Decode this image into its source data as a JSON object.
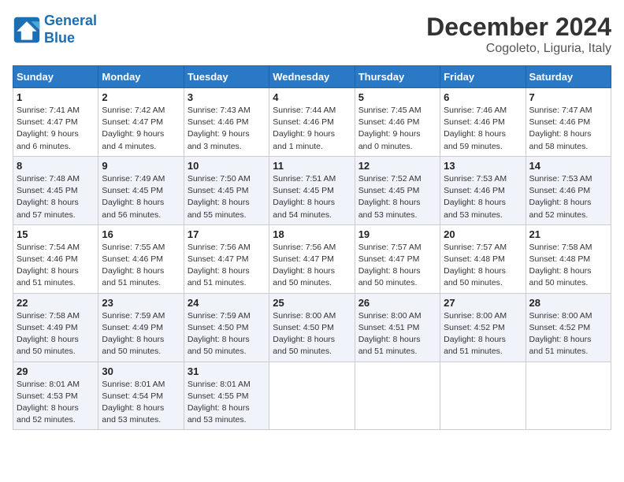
{
  "header": {
    "logo_line1": "General",
    "logo_line2": "Blue",
    "month": "December 2024",
    "location": "Cogoleto, Liguria, Italy"
  },
  "weekdays": [
    "Sunday",
    "Monday",
    "Tuesday",
    "Wednesday",
    "Thursday",
    "Friday",
    "Saturday"
  ],
  "weeks": [
    [
      {
        "day": "1",
        "info": "Sunrise: 7:41 AM\nSunset: 4:47 PM\nDaylight: 9 hours\nand 6 minutes."
      },
      {
        "day": "2",
        "info": "Sunrise: 7:42 AM\nSunset: 4:47 PM\nDaylight: 9 hours\nand 4 minutes."
      },
      {
        "day": "3",
        "info": "Sunrise: 7:43 AM\nSunset: 4:46 PM\nDaylight: 9 hours\nand 3 minutes."
      },
      {
        "day": "4",
        "info": "Sunrise: 7:44 AM\nSunset: 4:46 PM\nDaylight: 9 hours\nand 1 minute."
      },
      {
        "day": "5",
        "info": "Sunrise: 7:45 AM\nSunset: 4:46 PM\nDaylight: 9 hours\nand 0 minutes."
      },
      {
        "day": "6",
        "info": "Sunrise: 7:46 AM\nSunset: 4:46 PM\nDaylight: 8 hours\nand 59 minutes."
      },
      {
        "day": "7",
        "info": "Sunrise: 7:47 AM\nSunset: 4:46 PM\nDaylight: 8 hours\nand 58 minutes."
      }
    ],
    [
      {
        "day": "8",
        "info": "Sunrise: 7:48 AM\nSunset: 4:45 PM\nDaylight: 8 hours\nand 57 minutes."
      },
      {
        "day": "9",
        "info": "Sunrise: 7:49 AM\nSunset: 4:45 PM\nDaylight: 8 hours\nand 56 minutes."
      },
      {
        "day": "10",
        "info": "Sunrise: 7:50 AM\nSunset: 4:45 PM\nDaylight: 8 hours\nand 55 minutes."
      },
      {
        "day": "11",
        "info": "Sunrise: 7:51 AM\nSunset: 4:45 PM\nDaylight: 8 hours\nand 54 minutes."
      },
      {
        "day": "12",
        "info": "Sunrise: 7:52 AM\nSunset: 4:45 PM\nDaylight: 8 hours\nand 53 minutes."
      },
      {
        "day": "13",
        "info": "Sunrise: 7:53 AM\nSunset: 4:46 PM\nDaylight: 8 hours\nand 53 minutes."
      },
      {
        "day": "14",
        "info": "Sunrise: 7:53 AM\nSunset: 4:46 PM\nDaylight: 8 hours\nand 52 minutes."
      }
    ],
    [
      {
        "day": "15",
        "info": "Sunrise: 7:54 AM\nSunset: 4:46 PM\nDaylight: 8 hours\nand 51 minutes."
      },
      {
        "day": "16",
        "info": "Sunrise: 7:55 AM\nSunset: 4:46 PM\nDaylight: 8 hours\nand 51 minutes."
      },
      {
        "day": "17",
        "info": "Sunrise: 7:56 AM\nSunset: 4:47 PM\nDaylight: 8 hours\nand 51 minutes."
      },
      {
        "day": "18",
        "info": "Sunrise: 7:56 AM\nSunset: 4:47 PM\nDaylight: 8 hours\nand 50 minutes."
      },
      {
        "day": "19",
        "info": "Sunrise: 7:57 AM\nSunset: 4:47 PM\nDaylight: 8 hours\nand 50 minutes."
      },
      {
        "day": "20",
        "info": "Sunrise: 7:57 AM\nSunset: 4:48 PM\nDaylight: 8 hours\nand 50 minutes."
      },
      {
        "day": "21",
        "info": "Sunrise: 7:58 AM\nSunset: 4:48 PM\nDaylight: 8 hours\nand 50 minutes."
      }
    ],
    [
      {
        "day": "22",
        "info": "Sunrise: 7:58 AM\nSunset: 4:49 PM\nDaylight: 8 hours\nand 50 minutes."
      },
      {
        "day": "23",
        "info": "Sunrise: 7:59 AM\nSunset: 4:49 PM\nDaylight: 8 hours\nand 50 minutes."
      },
      {
        "day": "24",
        "info": "Sunrise: 7:59 AM\nSunset: 4:50 PM\nDaylight: 8 hours\nand 50 minutes."
      },
      {
        "day": "25",
        "info": "Sunrise: 8:00 AM\nSunset: 4:50 PM\nDaylight: 8 hours\nand 50 minutes."
      },
      {
        "day": "26",
        "info": "Sunrise: 8:00 AM\nSunset: 4:51 PM\nDaylight: 8 hours\nand 51 minutes."
      },
      {
        "day": "27",
        "info": "Sunrise: 8:00 AM\nSunset: 4:52 PM\nDaylight: 8 hours\nand 51 minutes."
      },
      {
        "day": "28",
        "info": "Sunrise: 8:00 AM\nSunset: 4:52 PM\nDaylight: 8 hours\nand 51 minutes."
      }
    ],
    [
      {
        "day": "29",
        "info": "Sunrise: 8:01 AM\nSunset: 4:53 PM\nDaylight: 8 hours\nand 52 minutes."
      },
      {
        "day": "30",
        "info": "Sunrise: 8:01 AM\nSunset: 4:54 PM\nDaylight: 8 hours\nand 53 minutes."
      },
      {
        "day": "31",
        "info": "Sunrise: 8:01 AM\nSunset: 4:55 PM\nDaylight: 8 hours\nand 53 minutes."
      },
      {
        "day": "",
        "info": ""
      },
      {
        "day": "",
        "info": ""
      },
      {
        "day": "",
        "info": ""
      },
      {
        "day": "",
        "info": ""
      }
    ]
  ]
}
